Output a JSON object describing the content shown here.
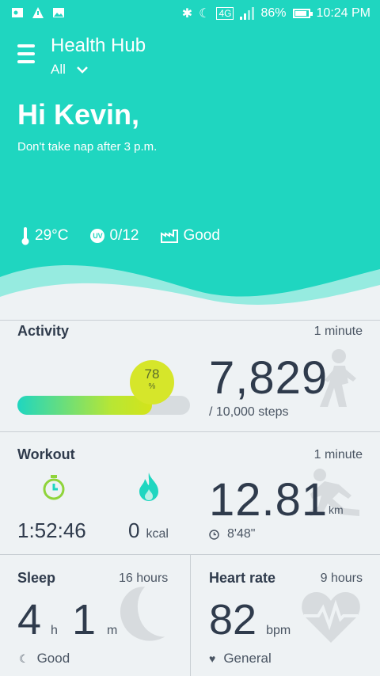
{
  "status_bar": {
    "network": "4G",
    "battery": "86%",
    "battery_level": 0.86,
    "time": "10:24 PM"
  },
  "header": {
    "app_title": "Health Hub",
    "filter_value": "All"
  },
  "greeting": {
    "title": "Hi Kevin,",
    "tip": "Don't take nap after 3 p.m."
  },
  "weather": {
    "temperature": "29°C",
    "uv_badge": "UV",
    "uv_index": "0/12",
    "air_quality": "Good"
  },
  "activity": {
    "title": "Activity",
    "updated": "1 minute",
    "steps": "7,829",
    "goal": "/ 10,000 steps",
    "progress_value": "78",
    "progress_unit": "%",
    "progress_fraction": 0.78
  },
  "workout": {
    "title": "Workout",
    "updated": "1 minute",
    "duration": "1:52:46",
    "calories_value": "0",
    "calories_unit": "kcal",
    "distance": "12.81",
    "distance_unit": "km",
    "pace": "8'48\""
  },
  "sleep": {
    "title": "Sleep",
    "updated": "16 hours",
    "hours_value": "4",
    "hours_unit": "h",
    "minutes_value": "1",
    "minutes_unit": "m",
    "quality": "Good"
  },
  "heart_rate": {
    "title": "Heart rate",
    "updated": "9 hours",
    "value": "82",
    "unit": "bpm",
    "status": "General"
  },
  "colors": {
    "accent": "#1fd6c0",
    "progress_end": "#d4e41a",
    "stopwatch": "#8fd43a",
    "flame": "#1fd6c0"
  }
}
